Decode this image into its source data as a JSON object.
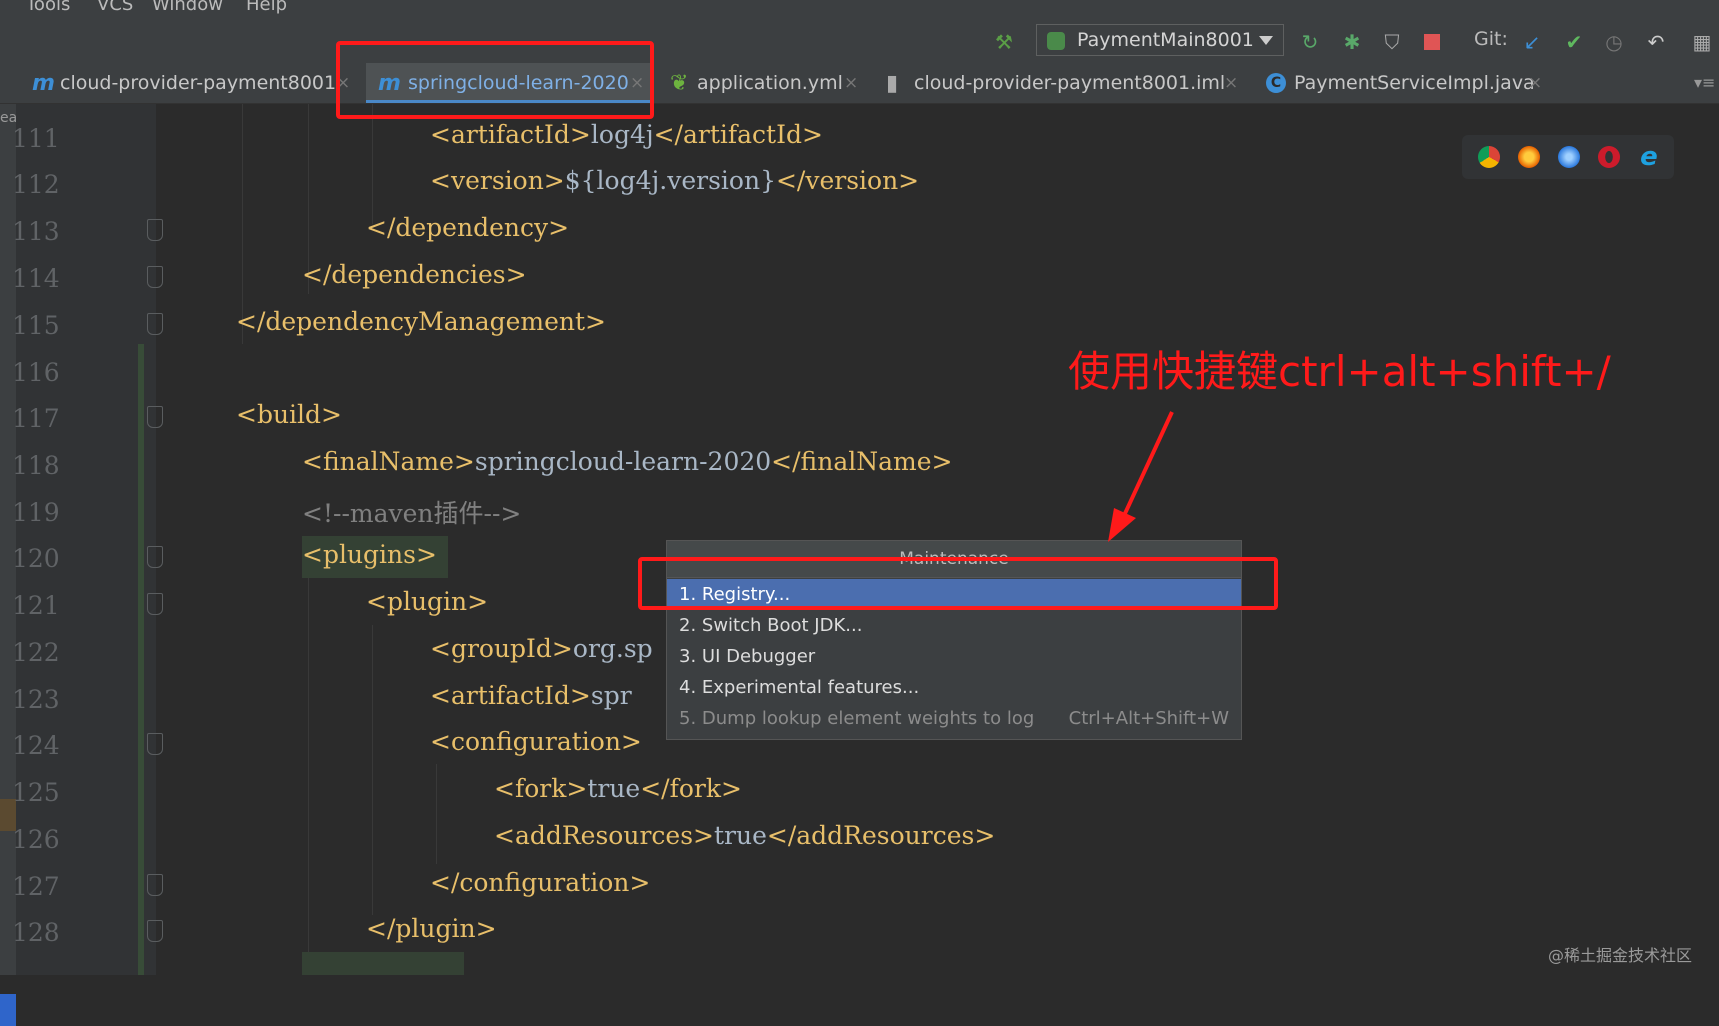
{
  "menubar": {
    "items": [
      "Tools",
      "VCS",
      "Window",
      "Help"
    ]
  },
  "toolbar": {
    "run_config": "PaymentMain8001",
    "git_label": "Git:"
  },
  "tabs": [
    {
      "icon": "m",
      "label": "cloud-provider-payment8001",
      "active": false
    },
    {
      "icon": "m",
      "label": "springcloud-learn-2020",
      "active": true
    },
    {
      "icon": "spring-leaf",
      "label": "application.yml",
      "active": false
    },
    {
      "icon": "module-file",
      "label": "cloud-provider-payment8001.iml",
      "active": false
    },
    {
      "icon": "C",
      "label": "PaymentServiceImpl.java",
      "active": false
    }
  ],
  "left_strip": {
    "text": "ea"
  },
  "editor": {
    "lines": [
      {
        "num": "111",
        "code": "<artifactId>log4j</artifactId>"
      },
      {
        "num": "112",
        "code": "<version>${log4j.version}</version>"
      },
      {
        "num": "113",
        "code": "</dependency>"
      },
      {
        "num": "114",
        "code": "</dependencies>"
      },
      {
        "num": "115",
        "code": "</dependencyManagement>"
      },
      {
        "num": "116",
        "code": ""
      },
      {
        "num": "117",
        "code": "<build>"
      },
      {
        "num": "118",
        "code": "<finalName>springcloud-learn-2020</finalName>"
      },
      {
        "num": "119",
        "code": "<!--maven插件-->"
      },
      {
        "num": "120",
        "code": "<plugins>"
      },
      {
        "num": "121",
        "code": "<plugin>"
      },
      {
        "num": "122",
        "code": "<groupId>org.sp"
      },
      {
        "num": "123",
        "code": "<artifactId>spr"
      },
      {
        "num": "124",
        "code": "<configuration>"
      },
      {
        "num": "125",
        "code": "<fork>true</fork>"
      },
      {
        "num": "126",
        "code": "<addResources>true</addResources>"
      },
      {
        "num": "127",
        "code": "</configuration>"
      },
      {
        "num": "128",
        "code": "</plugin>"
      }
    ]
  },
  "popup": {
    "title": "Maintenance",
    "items": [
      {
        "label": "1. Registry...",
        "shortcut": "",
        "selected": true
      },
      {
        "label": "2. Switch Boot JDK...",
        "shortcut": ""
      },
      {
        "label": "3. UI Debugger",
        "shortcut": ""
      },
      {
        "label": "4. Experimental features...",
        "shortcut": ""
      },
      {
        "label": "5. Dump lookup element weights to log",
        "shortcut": "Ctrl+Alt+Shift+W"
      }
    ]
  },
  "annotation": {
    "text": "使用快捷键ctrl+alt+shift+/",
    "color": "#ff1a1a"
  },
  "watermark": "@稀土掘金技术社区",
  "colors": {
    "editor_bg": "#2b2b2b",
    "tag": "#e8bf6a",
    "text": "#a9b7c6",
    "comment": "#808080",
    "selection": "#4b6eaf",
    "line_number": "#606366"
  }
}
